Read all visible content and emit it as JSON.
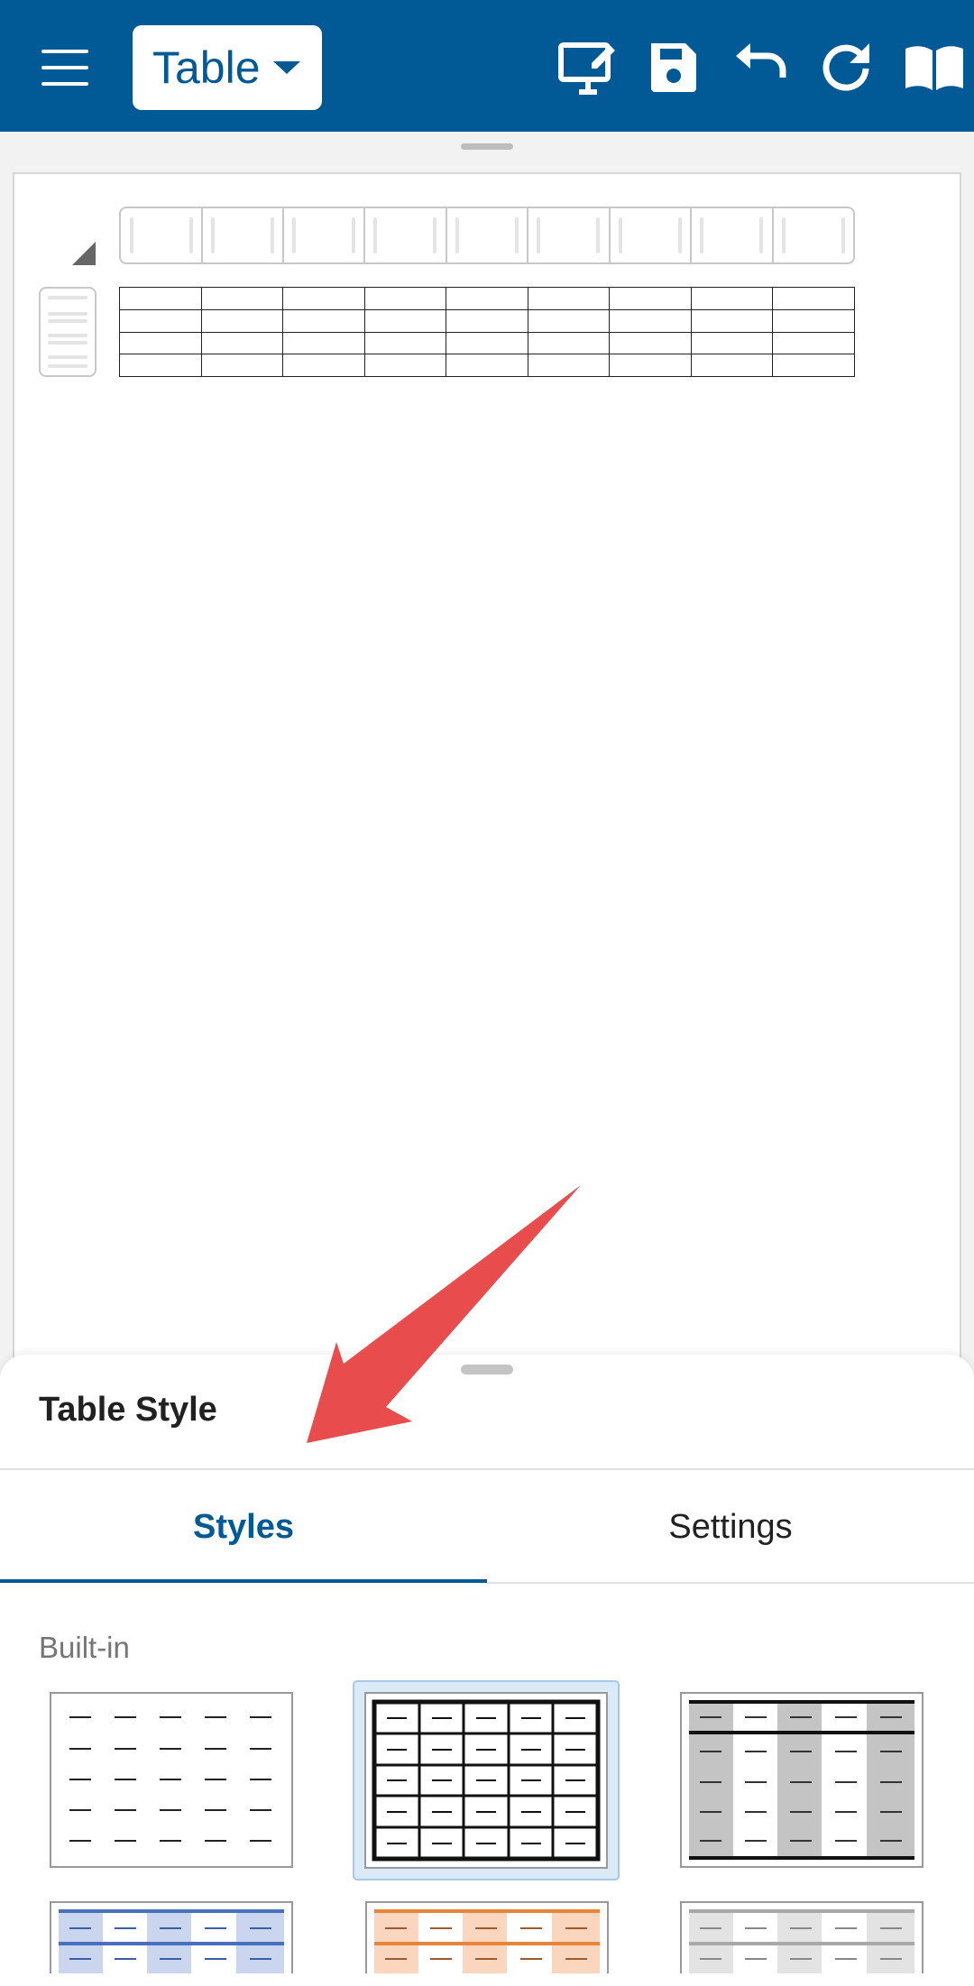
{
  "toolbar": {
    "mode_label": "Table",
    "icons": [
      "menu-icon",
      "present-edit-icon",
      "save-icon",
      "undo-icon",
      "redo-icon",
      "read-mode-icon"
    ]
  },
  "document": {
    "table": {
      "rows": 4,
      "columns": 9
    }
  },
  "panel": {
    "title": "Table Style",
    "tabs": [
      {
        "label": "Styles",
        "active": true
      },
      {
        "label": "Settings",
        "active": false
      }
    ],
    "section_label": "Built-in",
    "styles": [
      {
        "name": "plain-dashes",
        "selected": false
      },
      {
        "name": "grid-black",
        "selected": true
      },
      {
        "name": "banded-gray-columns",
        "selected": false
      },
      {
        "name": "banded-blue",
        "selected": false
      },
      {
        "name": "banded-orange",
        "selected": false
      },
      {
        "name": "banded-light-gray",
        "selected": false
      }
    ]
  },
  "colors": {
    "brand": "#015a96",
    "selected_bg": "#dbeaf7",
    "annotation_arrow": "#e84c4c"
  }
}
